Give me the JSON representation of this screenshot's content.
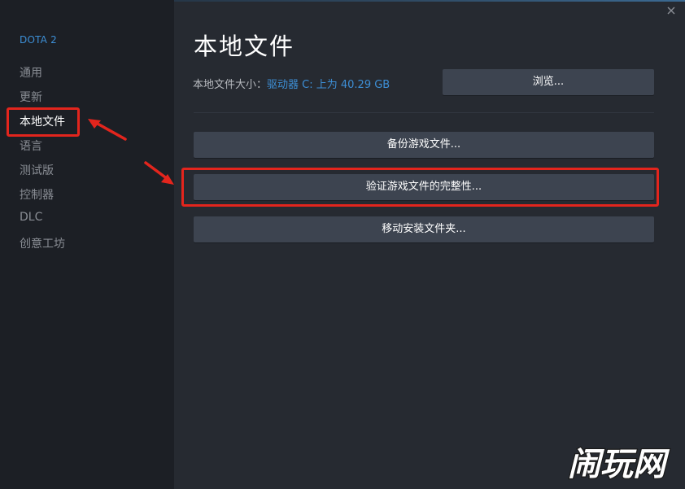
{
  "sidebar": {
    "game_title": "DOTA 2",
    "items": [
      {
        "label": "通用"
      },
      {
        "label": "更新"
      },
      {
        "label": "本地文件"
      },
      {
        "label": "语言"
      },
      {
        "label": "测试版"
      },
      {
        "label": "控制器"
      },
      {
        "label": "DLC"
      },
      {
        "label": "创意工坊"
      }
    ],
    "active_index": 2
  },
  "main": {
    "title": "本地文件",
    "size_label": "本地文件大小：",
    "size_value": "驱动器 C: 上为 40.29 GB",
    "browse_label": "浏览...",
    "backup_label": "备份游戏文件...",
    "verify_label": "验证游戏文件的完整性...",
    "move_label": "移动安装文件夹..."
  },
  "watermark": {
    "text": "闹玩网"
  },
  "colors": {
    "accent": "#3d8fd6",
    "annotation": "#e3251d",
    "button_bg": "#3d4450",
    "sidebar_bg": "#1c1f25",
    "content_bg": "#262a31"
  },
  "icons": {
    "close": "close-icon"
  }
}
